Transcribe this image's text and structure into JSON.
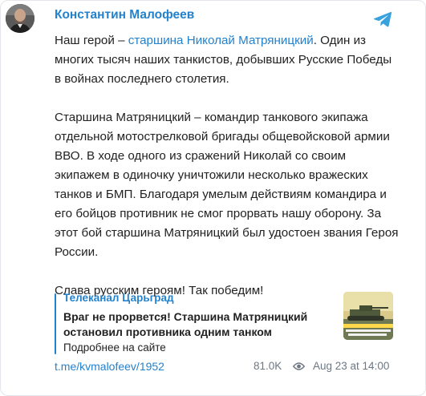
{
  "post": {
    "author": "Константин Малофеев",
    "paragraph1_prefix": "Наш герой – ",
    "paragraph1_link": "старшина Николай Матряницкий",
    "paragraph1_suffix": ". Один из многих тысяч наших танкистов, добывших Русские Победы в войнах последнего столетия.",
    "paragraph2": "Старшина Матряницкий – командир танкового экипажа отдельной мотострелковой бригады общевойсковой армии ВВО. В ходе одного из сражений Николай со своим экипажем в одиночку уничтожили несколько вражеских танков и БМП. Благодаря умелым действиям командира и его бойцов противник не смог прорвать нашу оборону. За этот бой старшина Матряницкий был удостоен звания Героя России.",
    "paragraph3": "Слава русским героям! Так победим!"
  },
  "link_preview": {
    "site_name": "Телеканал Царьград",
    "title": "Враг не прорвется! Старшина Матряницкий остановил противника одним танком",
    "more": "Подробнее на сайте"
  },
  "footer": {
    "post_link": "t.me/kvmalofeev/1952",
    "views": "81.0K",
    "date": "Aug 23 at 14:00"
  },
  "icons": {
    "avatar": "avatar",
    "telegram": "telegram-icon",
    "views": "eye-icon"
  },
  "colors": {
    "accent": "#2481cc",
    "text": "#222222",
    "muted": "#6d7883"
  }
}
